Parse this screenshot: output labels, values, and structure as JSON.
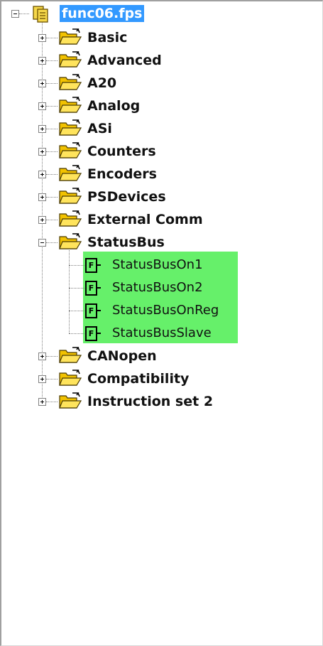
{
  "tree": {
    "root": {
      "label": "func06.fps",
      "icon": "project-file-icon",
      "expanded": true
    },
    "folders": [
      {
        "label": "Basic",
        "expanded": false
      },
      {
        "label": "Advanced",
        "expanded": false
      },
      {
        "label": "A20",
        "expanded": false
      },
      {
        "label": "Analog",
        "expanded": false
      },
      {
        "label": "ASi",
        "expanded": false
      },
      {
        "label": "Counters",
        "expanded": false
      },
      {
        "label": "Encoders",
        "expanded": false
      },
      {
        "label": "PSDevices",
        "expanded": false
      },
      {
        "label": "External Comm",
        "expanded": false
      },
      {
        "label": "StatusBus",
        "expanded": true
      },
      {
        "label": "CANopen",
        "expanded": false
      },
      {
        "label": "Compatibility",
        "expanded": false
      },
      {
        "label": "Instruction set 2",
        "expanded": false
      }
    ],
    "statusbus_functions": [
      {
        "label": "StatusBusOn1",
        "icon_letter": "F"
      },
      {
        "label": "StatusBusOn2",
        "icon_letter": "F"
      },
      {
        "label": "StatusBusOnReg",
        "icon_letter": "F"
      },
      {
        "label": "StatusBusSlave",
        "icon_letter": "F"
      }
    ]
  },
  "colors": {
    "selection": "#3399ff",
    "function_highlight": "#66f06a",
    "folder_yellow": "#f2c200"
  }
}
